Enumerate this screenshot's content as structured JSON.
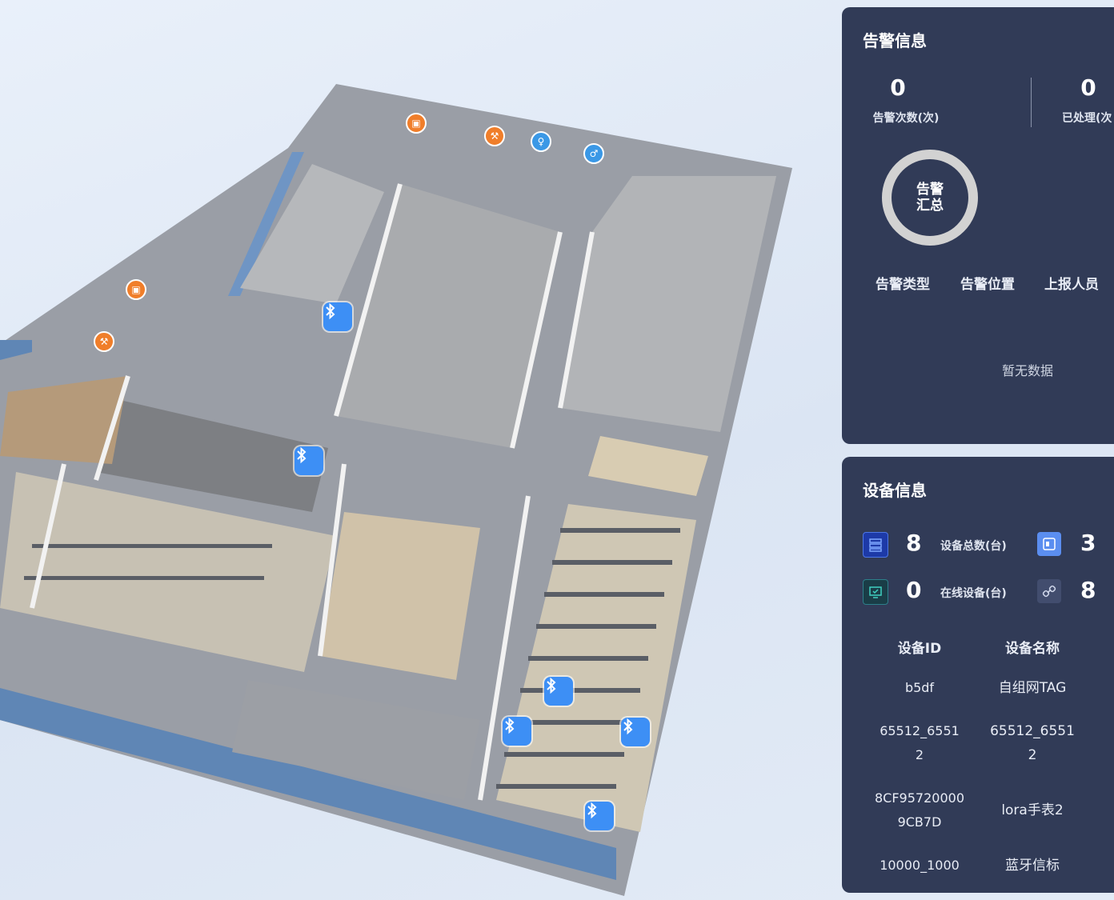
{
  "alarm_panel": {
    "title": "告警信息",
    "stats": [
      {
        "value": "0",
        "label": "告警次数(次)"
      },
      {
        "value": "0",
        "label": "已处理(次"
      }
    ],
    "donut_label": "告警汇总",
    "columns": [
      "告警类型",
      "告警位置",
      "上报人员"
    ],
    "empty_text": "暂无数据",
    "colors": {
      "panel_bg": "#313b57",
      "donut_ring": "#d2d2d2"
    }
  },
  "device_panel": {
    "title": "设备信息",
    "summary": [
      {
        "icon": "server-icon",
        "value": "8",
        "label": "设备总数(台)"
      },
      {
        "icon": "device-card-icon",
        "value": "3",
        "label": ""
      },
      {
        "icon": "monitor-icon",
        "value": "0",
        "label": "在线设备(台)"
      },
      {
        "icon": "link-icon",
        "value": "8",
        "label": ""
      }
    ],
    "table": {
      "headers": [
        "设备ID",
        "设备名称"
      ],
      "rows": [
        {
          "id": "b5df",
          "name": "自组网TAG"
        },
        {
          "id": "65512_65512",
          "name": "65512_65512"
        },
        {
          "id": "8CF957200009CB7D",
          "name": "lora手表2"
        },
        {
          "id": "10000_1000",
          "name": "蓝牙信标"
        }
      ]
    }
  },
  "map": {
    "markers": [
      {
        "type": "bluetooth",
        "icon": "bluetooth-icon"
      },
      {
        "type": "bluetooth",
        "icon": "bluetooth-icon"
      },
      {
        "type": "bluetooth",
        "icon": "bluetooth-icon"
      },
      {
        "type": "bluetooth",
        "icon": "bluetooth-icon"
      },
      {
        "type": "bluetooth",
        "icon": "bluetooth-icon"
      },
      {
        "type": "bluetooth",
        "icon": "bluetooth-icon"
      }
    ],
    "pois": [
      {
        "icon": "elevator-icon",
        "color": "#f07e2a"
      },
      {
        "icon": "stairs-icon",
        "color": "#f07e2a"
      },
      {
        "icon": "restroom-female-icon",
        "color": "#3a98e6"
      },
      {
        "icon": "restroom-male-icon",
        "color": "#3a98e6"
      },
      {
        "icon": "elevator-icon",
        "color": "#f07e2a"
      },
      {
        "icon": "stairs-icon",
        "color": "#f07e2a"
      }
    ]
  }
}
